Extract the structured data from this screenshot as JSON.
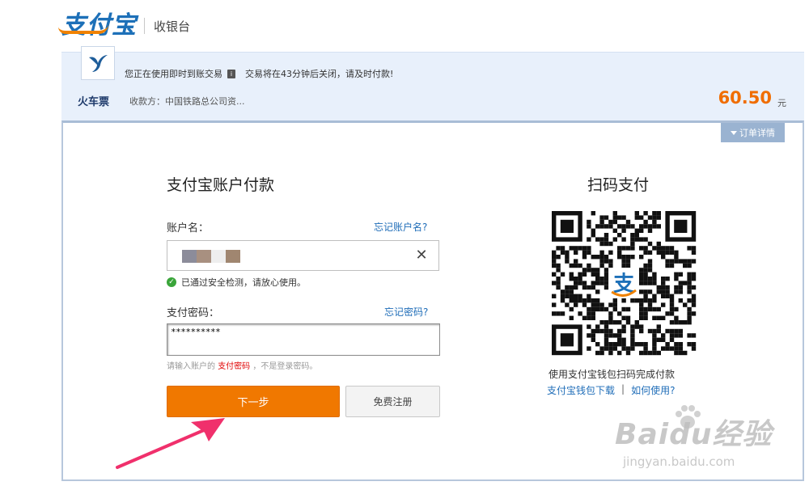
{
  "header": {
    "logo_text": "支付宝",
    "subtitle": "收银台"
  },
  "order": {
    "notice": "您正在使用即时到账交易",
    "info_icon": "info-icon",
    "close_warning": "交易将在43分钟后关闭，请及时付款!",
    "name": "火车票",
    "payee": "收款方：中国铁路总公司资...",
    "amount": "60.50",
    "unit": "元",
    "details_tab": "订单详情"
  },
  "login": {
    "title": "支付宝账户付款",
    "account_label": "账户名：",
    "forgot_account": "忘记账户名?",
    "security_check": "已通过安全检测，请放心使用。",
    "password_label": "支付密码：",
    "forgot_password": "忘记密码?",
    "password_value": "**********",
    "hint_prefix": "请输入账户的",
    "hint_emphasis": "支付密码",
    "hint_suffix": "，不是登录密码。",
    "next_button": "下一步",
    "register_button": "免费注册"
  },
  "qr": {
    "title": "扫码支付",
    "caption": "使用支付宝钱包扫码完成付款",
    "download_link": "支付宝钱包下载",
    "separator": "|",
    "howto_link": "如何使用?"
  },
  "watermark": {
    "main": "Baidu经验",
    "sub": "jingyan.baidu.com"
  },
  "colors": {
    "brand_blue": "#1d70b8",
    "accent_orange": "#f07800",
    "amount_orange": "#f06d00",
    "link_blue": "#1f6db8",
    "arrow_pink": "#f0306c",
    "band_bg": "#e8f0fb"
  }
}
